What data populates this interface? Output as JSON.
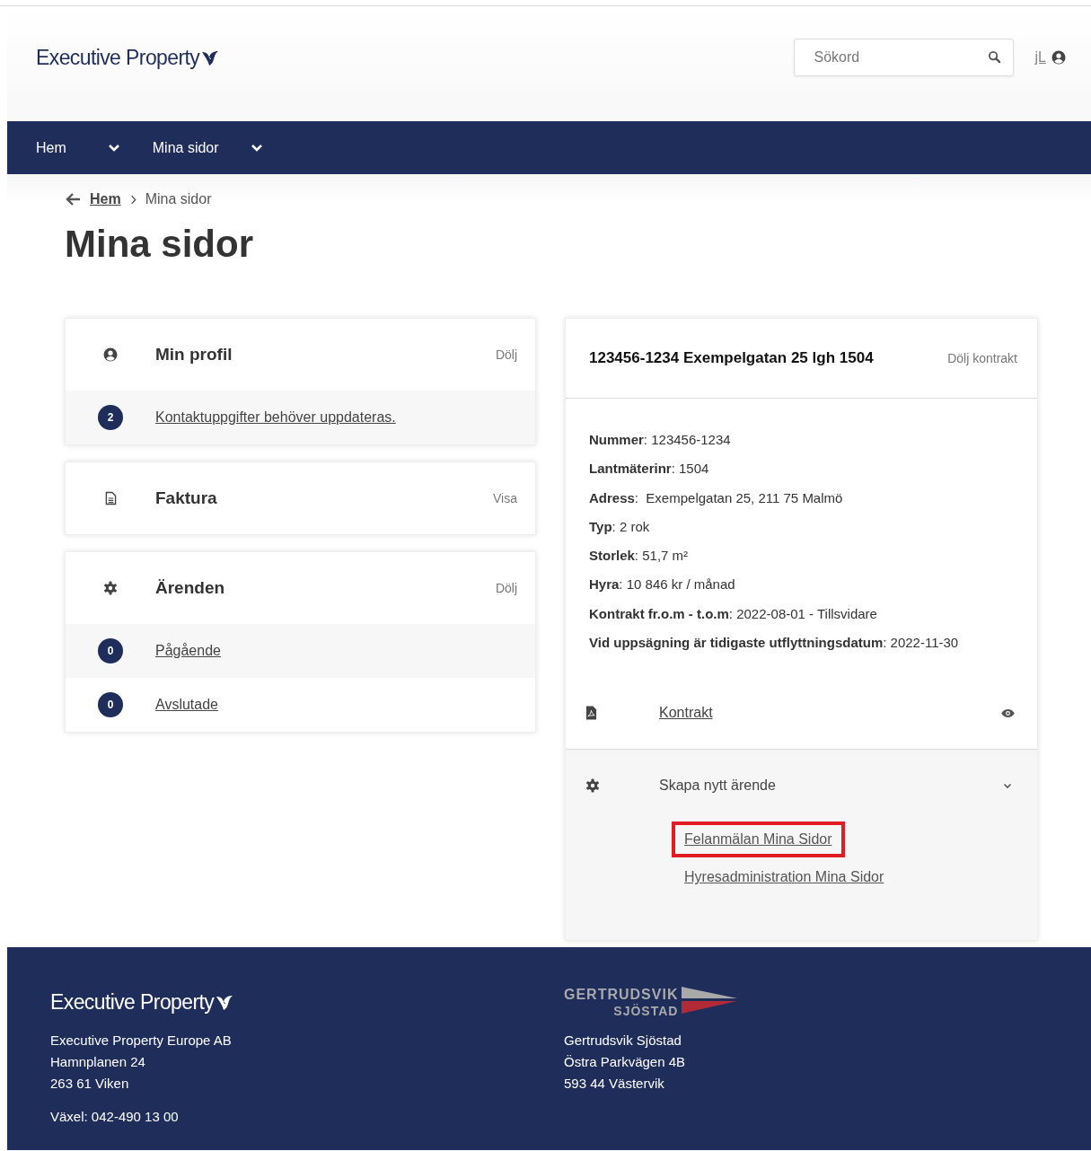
{
  "header": {
    "logo": "Executive Property",
    "search": {
      "placeholder": "Sökord"
    },
    "user": "jL"
  },
  "nav": [
    {
      "label": "Hem",
      "has_dropdown": true
    },
    {
      "label": "Mina sidor",
      "has_dropdown": true
    }
  ],
  "breadcrumb": [
    {
      "label": "Hem",
      "link": true
    },
    {
      "label": "Mina sidor",
      "link": false
    }
  ],
  "page_title": "Mina sidor",
  "cards": [
    {
      "kind": "profile",
      "title": "Min profil",
      "action": "Dölj",
      "rows": [
        {
          "count": "2",
          "label": "Kontaktuppgifter behöver uppdateras."
        }
      ]
    },
    {
      "kind": "invoice",
      "title": "Faktura",
      "action": "Visa"
    },
    {
      "kind": "cases",
      "title": "Ärenden",
      "action": "Dölj",
      "rows": [
        {
          "count": "0",
          "label": "Pågående"
        },
        {
          "count": "0",
          "label": "Avslutade"
        }
      ]
    }
  ],
  "contract": {
    "title": "123456-1234 Exempelgatan 25 lgh 1504",
    "action": "Dölj kontrakt",
    "fields": [
      "**Nummer**: 123456-1234",
      "**Lantmäterinr**: 1504",
      "**Adress**:  Exempelgatan 25, 211 75 Malmö",
      "**Typ**: 2 rok",
      "**Storlek**: 51,7 m²",
      "**Hyra**: 10 846 kr / månad",
      "**Kontrakt fr.o.m - t.o.m**: 2022-08-01 - Tillsvidare",
      "**Vid uppsägning är tidigaste utflyttningsdatum**: 2022-11-30"
    ],
    "document": {
      "label": "Kontrakt"
    },
    "new_case": {
      "label": "Skapa nytt ärende",
      "expanded": true,
      "links": [
        {
          "label": "Felanmälan Mina Sidor",
          "highlighted": true
        },
        {
          "label": "Hyresadministration Mina Sidor",
          "highlighted": false
        }
      ]
    }
  },
  "footer": [
    {
      "kind": "executive",
      "logo": "Executive Property",
      "lines": [
        "Executive Property Europe AB",
        "Hamnplanen 24",
        "263 61 Viken"
      ],
      "phone": "Växel: 042-490 13 00"
    },
    {
      "kind": "gertrudsvik",
      "logo_lines": [
        "GERTRUDSVIK",
        "SJÖSTAD"
      ],
      "lines": [
        "Gertrudsvik Sjöstad",
        "Östra Parkvägen 4B",
        "593 44 Västervik"
      ]
    }
  ]
}
